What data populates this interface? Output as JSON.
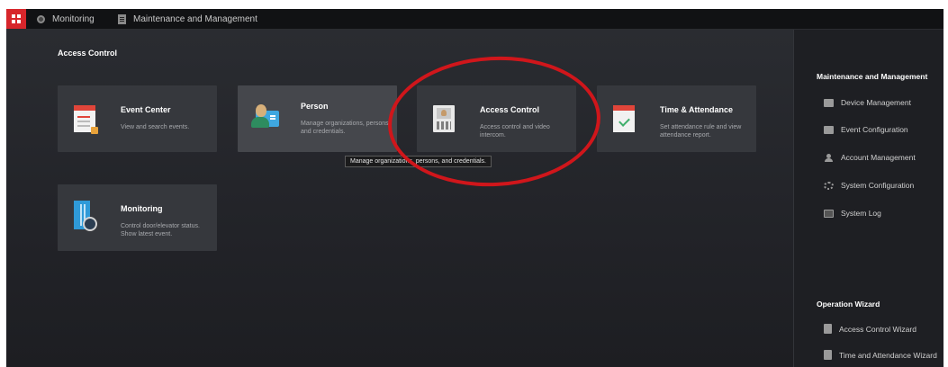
{
  "topbar": {
    "tabs": [
      {
        "label": "Monitoring",
        "icon": "monitoring-icon"
      },
      {
        "label": "Maintenance and Management",
        "icon": "maintenance-icon"
      }
    ]
  },
  "main": {
    "section_title": "Access Control",
    "tiles": [
      {
        "name": "Event Center",
        "desc": "View and search events.",
        "icon": "event-center-icon"
      },
      {
        "name": "Person",
        "desc": "Manage organizations, persons, and credentials.",
        "icon": "person-icon"
      },
      {
        "name": "Access Control",
        "desc": "Access control and video intercom.",
        "icon": "access-control-icon"
      },
      {
        "name": "Time & Attendance",
        "desc": "Set attendance rule and view attendance report.",
        "icon": "time-attendance-icon"
      },
      {
        "name": "Monitoring",
        "desc": "Control door/elevator status. Show latest event.",
        "icon": "monitoring-door-icon"
      }
    ],
    "tooltip": "Manage organizations, persons, and credentials."
  },
  "right_panel": {
    "maintenance_title": "Maintenance and Management",
    "maintenance_items": [
      {
        "label": "Device Management",
        "icon": "device-icon"
      },
      {
        "label": "Event Configuration",
        "icon": "event-config-icon"
      },
      {
        "label": "Account Management",
        "icon": "user-icon"
      },
      {
        "label": "System Configuration",
        "icon": "gear-icon"
      },
      {
        "label": "System Log",
        "icon": "log-icon"
      }
    ],
    "wizard_title": "Operation Wizard",
    "wizard_items": [
      {
        "label": "Access Control Wizard",
        "icon": "wizard-icon"
      },
      {
        "label": "Time and Attendance Wizard",
        "icon": "wizard-icon"
      }
    ]
  },
  "colors": {
    "brand_red": "#d7262b",
    "annotation_circle": "#d0161b",
    "tile_bg": "#36383d",
    "panel_bg": "#1e1f23"
  }
}
